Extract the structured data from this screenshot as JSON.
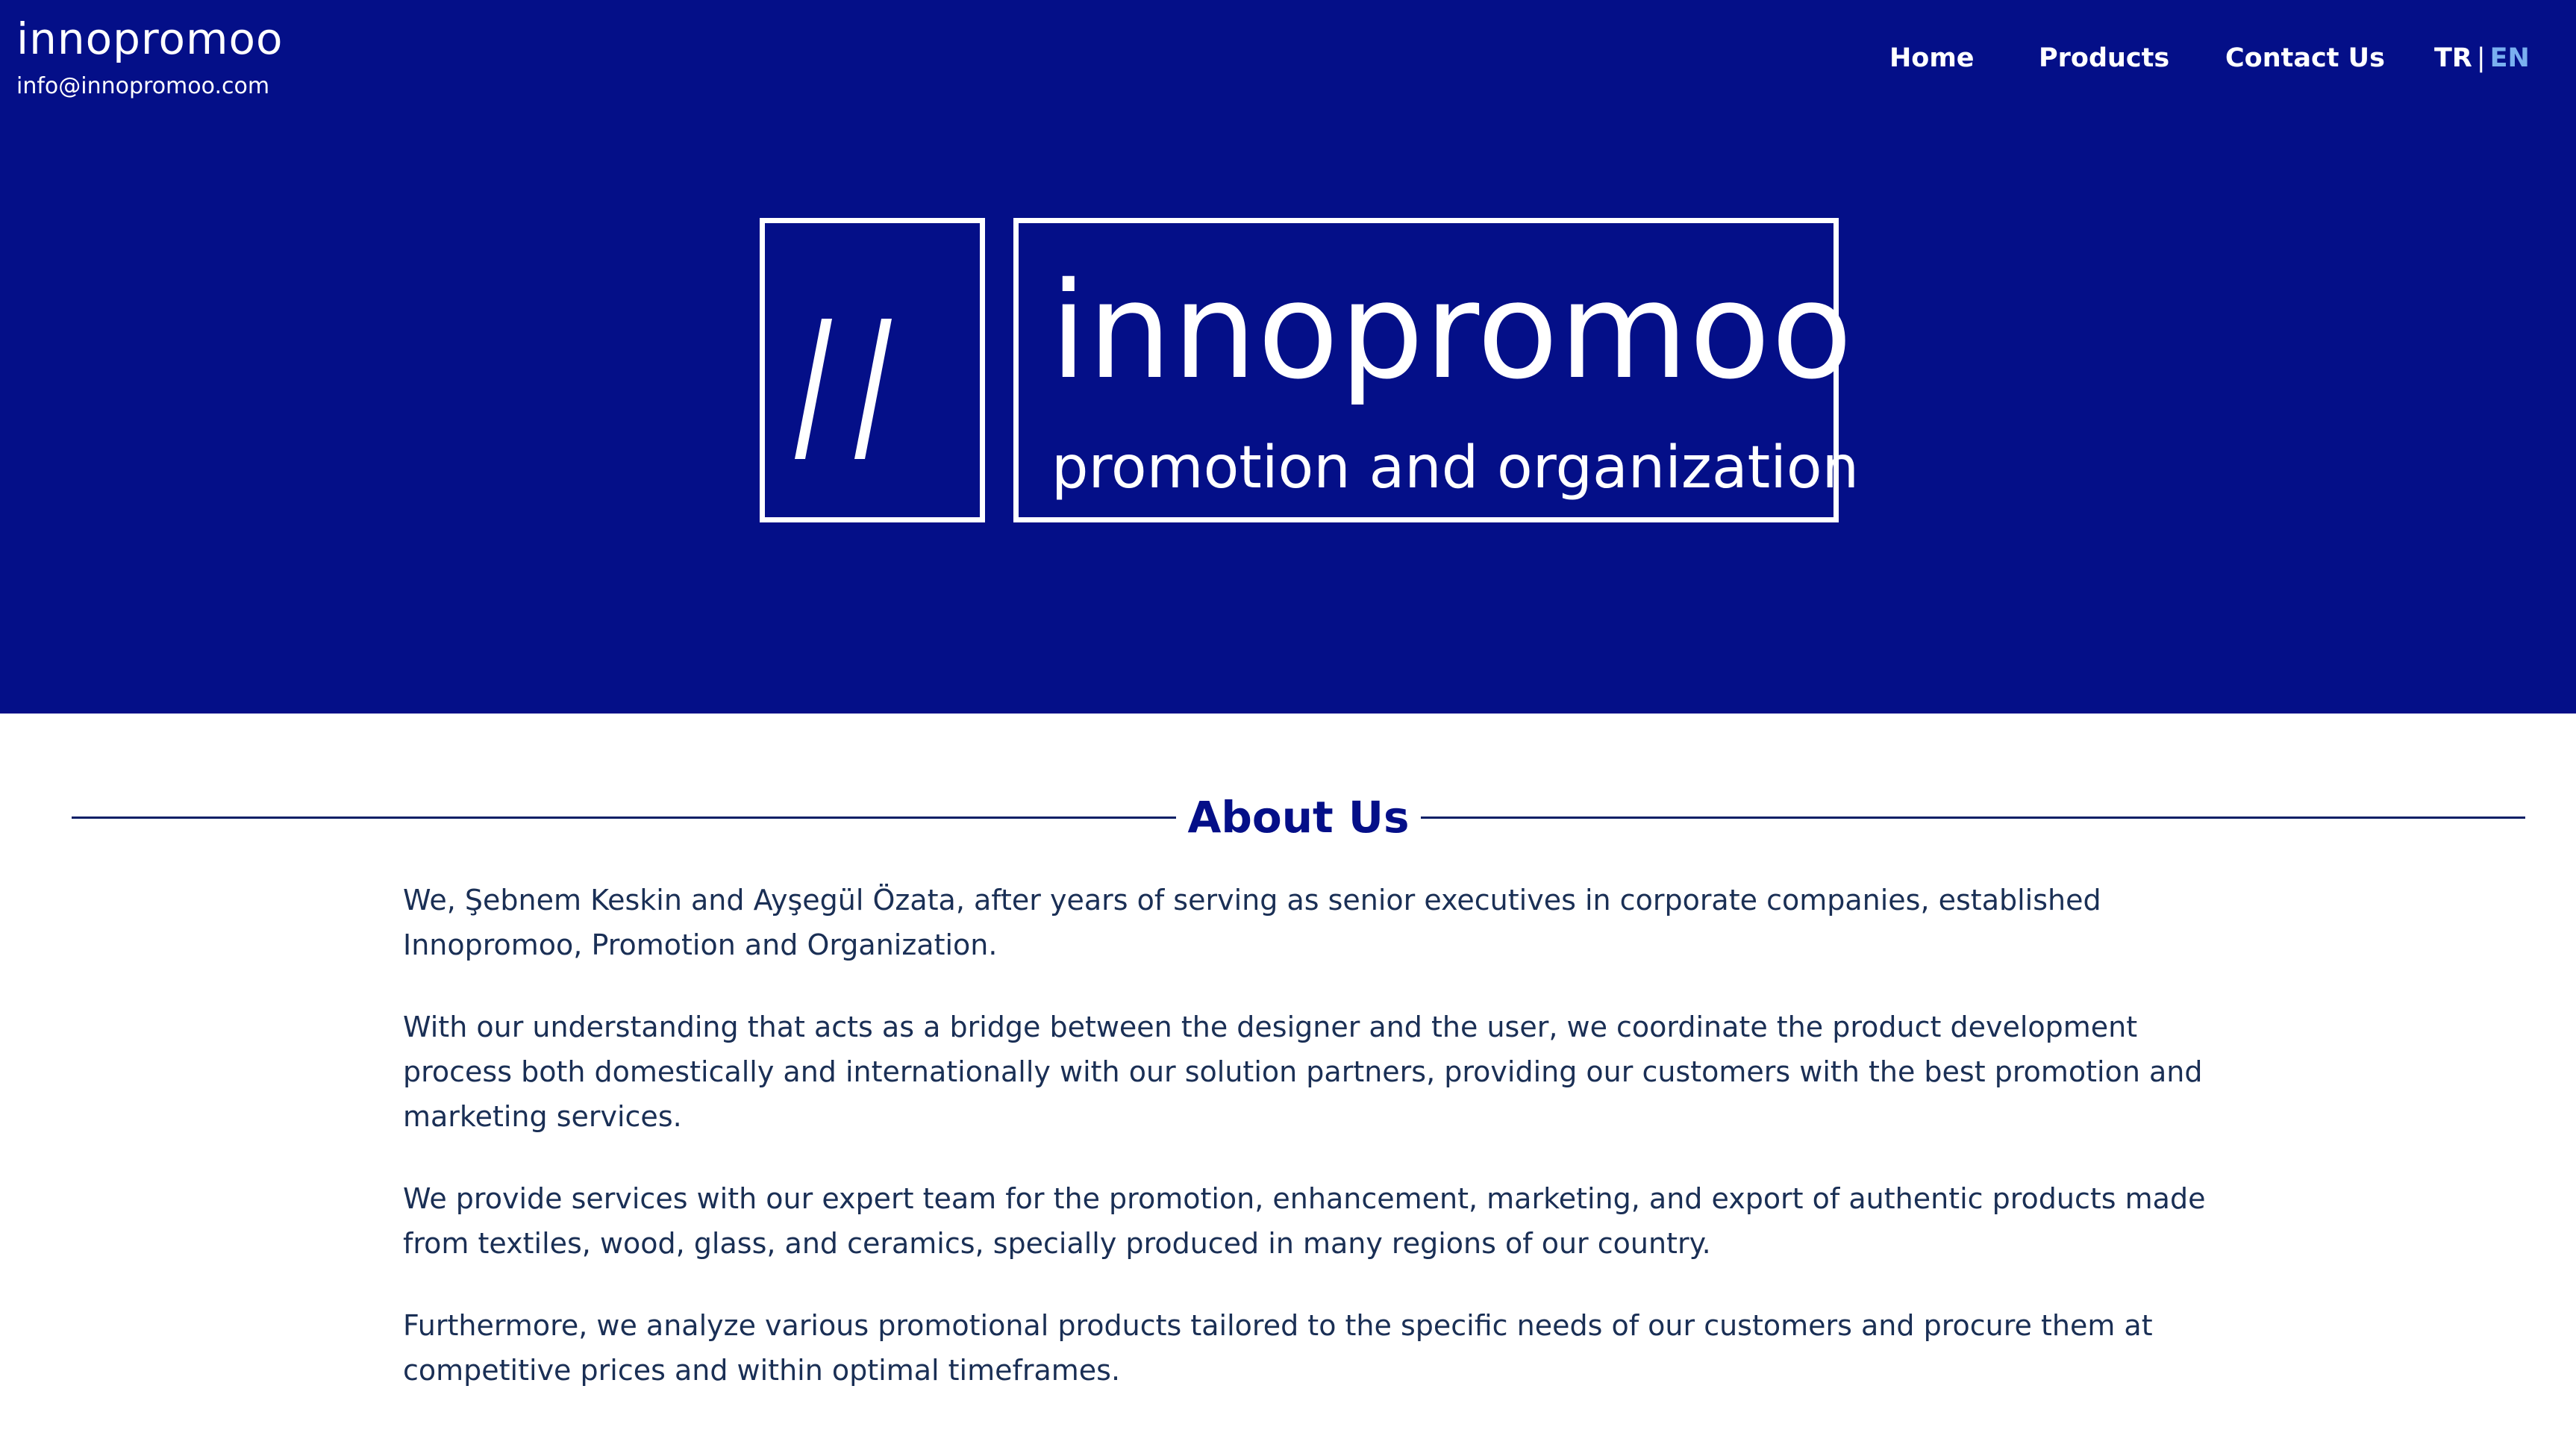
{
  "header": {
    "brand_name": "innopromoo",
    "email": "info@innopromoo.com",
    "nav": {
      "home": "Home",
      "products": "Products",
      "contact": "Contact Us"
    },
    "lang": {
      "tr": "TR",
      "separator": "|",
      "en": "EN"
    }
  },
  "logo": {
    "title": "innopromoo",
    "tagline": "promotion and organization",
    "mark_icon": "double-slash-icon"
  },
  "about": {
    "title": "About Us",
    "paragraphs": [
      "We, Şebnem Keskin and Ayşegül Özata, after years of serving as senior executives in corporate companies, established Innopromoo, Promotion and Organization.",
      "With our understanding that acts as a bridge between the designer and the user, we coordinate the product development process both domestically and internationally with our solution partners, providing our customers with the best promotion and marketing services.",
      "We provide services with our expert team for the promotion, enhancement, marketing, and export of authentic products made from textiles, wood, glass, and ceramics, specially produced in many regions of our country.",
      "Furthermore, we analyze various promotional products tailored to the specific needs of our customers and procure them at competitive prices and within optimal timeframes."
    ]
  },
  "colors": {
    "hero_background": "#040f88",
    "heading": "#040f88",
    "body_text": "#1a2f55",
    "active_lang": "#7ab0f0"
  }
}
